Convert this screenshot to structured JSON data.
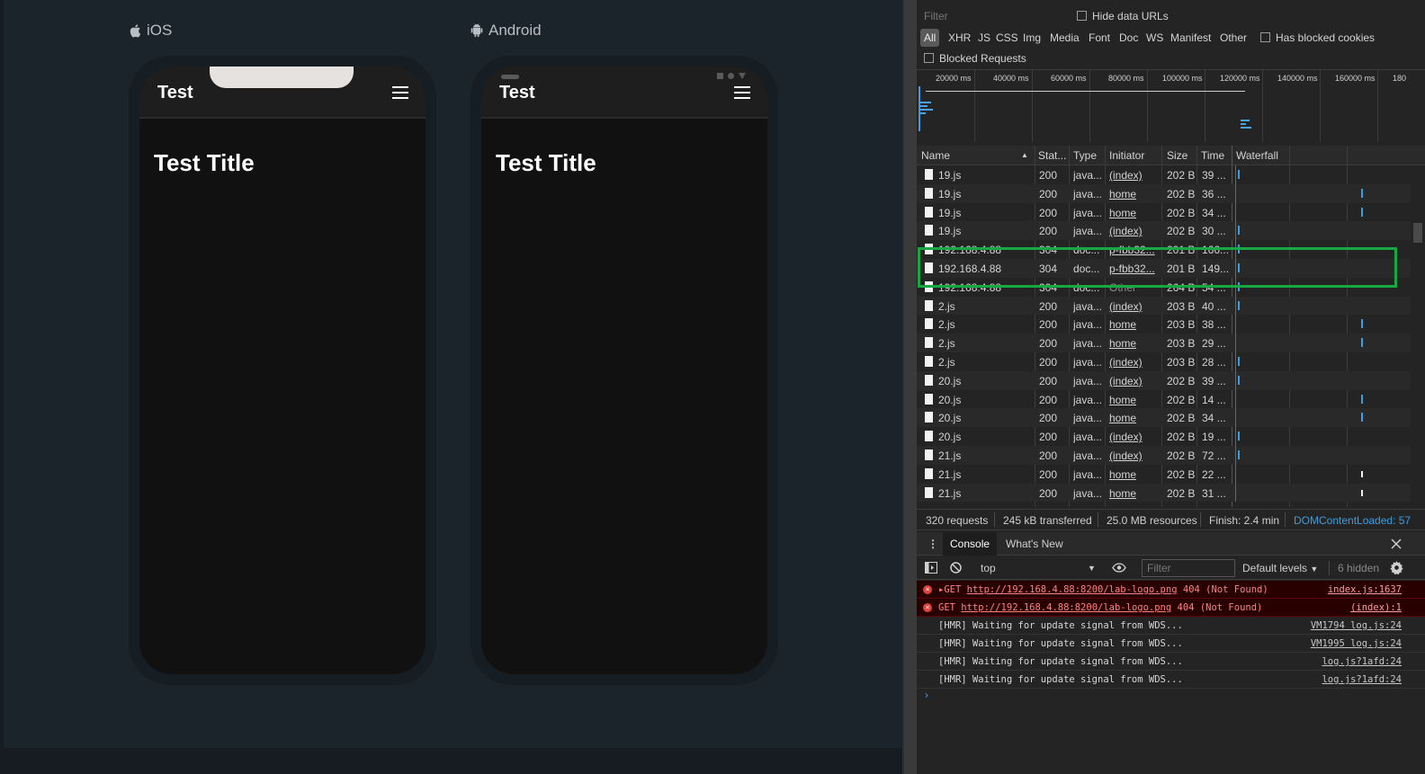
{
  "preview": {
    "ios_label": "iOS",
    "android_label": "Android",
    "ios_toolbar_title": "Test",
    "android_toolbar_title": "Test",
    "ios_page_title": "Test Title",
    "android_page_title": "Test Title"
  },
  "network": {
    "filter_placeholder": "Filter",
    "hide_data_urls": "Hide data URLs",
    "types": [
      "All",
      "XHR",
      "JS",
      "CSS",
      "Img",
      "Media",
      "Font",
      "Doc",
      "WS",
      "Manifest",
      "Other"
    ],
    "has_blocked_cookies": "Has blocked cookies",
    "blocked_requests": "Blocked Requests",
    "overview_ticks": [
      "20000 ms",
      "40000 ms",
      "60000 ms",
      "80000 ms",
      "100000 ms",
      "120000 ms",
      "140000 ms",
      "160000 ms",
      "180"
    ],
    "columns": [
      "Name",
      "Stat...",
      "Type",
      "Initiator",
      "Size",
      "Time",
      "Waterfall"
    ],
    "rows": [
      {
        "name": "19.js",
        "status": "200",
        "type": "java...",
        "initiator": "(index)",
        "size": "202 B",
        "time": "39 ...",
        "wf": "start"
      },
      {
        "name": "19.js",
        "status": "200",
        "type": "java...",
        "initiator": "home",
        "size": "202 B",
        "time": "36 ...",
        "wf": "end"
      },
      {
        "name": "19.js",
        "status": "200",
        "type": "java...",
        "initiator": "home",
        "size": "202 B",
        "time": "34 ...",
        "wf": "end"
      },
      {
        "name": "19.js",
        "status": "200",
        "type": "java...",
        "initiator": "(index)",
        "size": "202 B",
        "time": "30 ...",
        "wf": "start"
      },
      {
        "name": "192.168.4.88",
        "status": "304",
        "type": "doc...",
        "initiator": "p-fbb32...",
        "size": "201 B",
        "time": "166...",
        "wf": "start"
      },
      {
        "name": "192.168.4.88",
        "status": "304",
        "type": "doc...",
        "initiator": "p-fbb32...",
        "size": "201 B",
        "time": "149...",
        "wf": "start"
      },
      {
        "name": "192.168.4.88",
        "status": "304",
        "type": "doc...",
        "initiator": "Other",
        "size": "264 B",
        "time": "54 ...",
        "wf": "start"
      },
      {
        "name": "2.js",
        "status": "200",
        "type": "java...",
        "initiator": "(index)",
        "size": "203 B",
        "time": "40 ...",
        "wf": "start"
      },
      {
        "name": "2.js",
        "status": "200",
        "type": "java...",
        "initiator": "home",
        "size": "203 B",
        "time": "38 ...",
        "wf": "end"
      },
      {
        "name": "2.js",
        "status": "200",
        "type": "java...",
        "initiator": "home",
        "size": "203 B",
        "time": "29 ...",
        "wf": "end"
      },
      {
        "name": "2.js",
        "status": "200",
        "type": "java...",
        "initiator": "(index)",
        "size": "203 B",
        "time": "28 ...",
        "wf": "start"
      },
      {
        "name": "20.js",
        "status": "200",
        "type": "java...",
        "initiator": "(index)",
        "size": "202 B",
        "time": "39 ...",
        "wf": "start"
      },
      {
        "name": "20.js",
        "status": "200",
        "type": "java...",
        "initiator": "home",
        "size": "202 B",
        "time": "14 ...",
        "wf": "end"
      },
      {
        "name": "20.js",
        "status": "200",
        "type": "java...",
        "initiator": "home",
        "size": "202 B",
        "time": "34 ...",
        "wf": "end"
      },
      {
        "name": "20.js",
        "status": "200",
        "type": "java...",
        "initiator": "(index)",
        "size": "202 B",
        "time": "19 ...",
        "wf": "start"
      },
      {
        "name": "21.js",
        "status": "200",
        "type": "java...",
        "initiator": "(index)",
        "size": "202 B",
        "time": "72 ...",
        "wf": "start"
      },
      {
        "name": "21.js",
        "status": "200",
        "type": "java...",
        "initiator": "home",
        "size": "202 B",
        "time": "22 ...",
        "wf": "end-white"
      },
      {
        "name": "21.js",
        "status": "200",
        "type": "java...",
        "initiator": "home",
        "size": "202 B",
        "time": "31 ...",
        "wf": "end-white"
      }
    ],
    "status": {
      "requests": "320 requests",
      "transferred": "245 kB transferred",
      "resources": "25.0 MB resources",
      "finish": "Finish: 2.4 min",
      "dom_content_loaded": "DOMContentLoaded: 57"
    }
  },
  "drawer": {
    "tabs": [
      "Console",
      "What's New"
    ],
    "context": "top",
    "filter_placeholder": "Filter",
    "levels": "Default levels",
    "hidden": "6 hidden",
    "messages": [
      {
        "kind": "error",
        "expand": true,
        "method": "GET",
        "url": "http://192.168.4.88:8200/lab-logo.png",
        "suffix": "404 (Not Found)",
        "source": "index.js:1637"
      },
      {
        "kind": "error",
        "expand": false,
        "method": "GET",
        "url": "http://192.168.4.88:8200/lab-logo.png",
        "suffix": "404 (Not Found)",
        "source": "(index):1"
      },
      {
        "kind": "log",
        "text": "[HMR] Waiting for update signal from WDS...",
        "source": "VM1794 log.js:24"
      },
      {
        "kind": "log",
        "text": "[HMR] Waiting for update signal from WDS...",
        "source": "VM1995 log.js:24"
      },
      {
        "kind": "log",
        "text": "[HMR] Waiting for update signal from WDS...",
        "source": "log.js?1afd:24"
      },
      {
        "kind": "log",
        "text": "[HMR] Waiting for update signal from WDS...",
        "source": "log.js?1afd:24"
      }
    ]
  }
}
